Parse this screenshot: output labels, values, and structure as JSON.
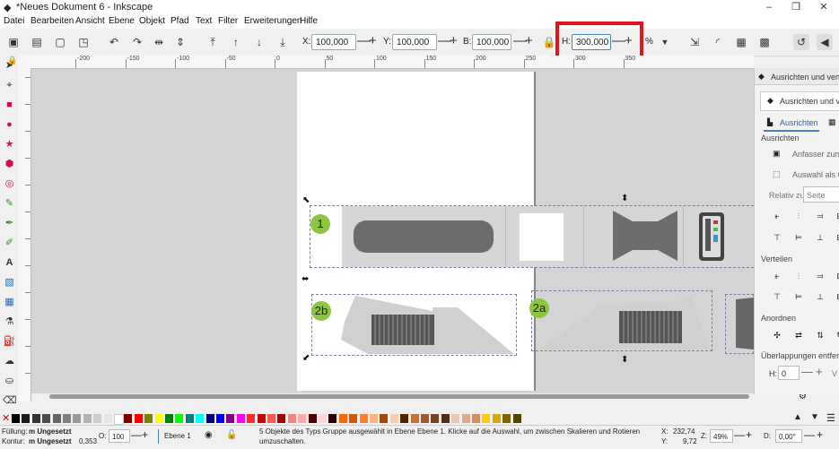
{
  "window": {
    "title": "*Neues Dokument 6 - Inkscape",
    "controls": [
      "–",
      "❐",
      "✕"
    ]
  },
  "menu": [
    "Datei",
    "Bearbeiten",
    "Ansicht",
    "Ebene",
    "Objekt",
    "Pfad",
    "Text",
    "Filter",
    "Erweiterungen",
    "Hilfe"
  ],
  "toolbar": {
    "x_label": "X:",
    "x_value": "100,000",
    "y_label": "Y:",
    "y_value": "100,000",
    "w_label": "B:",
    "w_value": "100,000",
    "h_label": "H:",
    "h_value": "300,000",
    "unit": "%",
    "minus": "—",
    "plus": "+"
  },
  "ruler": {
    "labels": [
      "-200",
      "-150",
      "-100",
      "-50",
      "0",
      "50",
      "100",
      "150",
      "200",
      "250",
      "300",
      "350"
    ]
  },
  "canvas": {
    "badges": [
      "1",
      "2b",
      "2a"
    ]
  },
  "dock": {
    "panel_title": "Ausrichten und verte",
    "tab_title": "Ausrichten und ve",
    "subtab": "Ausrichten",
    "section_align": "Ausrichten",
    "anchor_label": "Anfasser zum A",
    "selection_label": "Auswahl als Ga",
    "relative_label": "Relativ zu:",
    "relative_value": "Seite",
    "section_distribute": "Verteilen",
    "section_arrange": "Anordnen",
    "section_overlap": "Überlappungen entfern",
    "h_label": "H:",
    "h_value": "0",
    "v_label": "V"
  },
  "palette": {
    "colors": [
      "#000000",
      "#1a1a1a",
      "#333333",
      "#4d4d4d",
      "#666666",
      "#808080",
      "#999999",
      "#b3b3b3",
      "#cccccc",
      "#e6e6e6",
      "#ffffff",
      "#800000",
      "#ff0000",
      "#808000",
      "#ffff00",
      "#008000",
      "#00ff00",
      "#008080",
      "#00ffff",
      "#000080",
      "#0000ff",
      "#800080",
      "#ff00ff",
      "#ff2a2a",
      "#d40000",
      "#ff5555",
      "#aa0000",
      "#ff8080",
      "#ffaaaa",
      "#550000",
      "#ffd5d5",
      "#2b0000",
      "#ff6600",
      "#d45500",
      "#ff7f2a",
      "#ffb380",
      "#aa4400",
      "#ffccaa",
      "#552200",
      "#c87137",
      "#a05a2c",
      "#784421",
      "#502d16",
      "#e9c6af",
      "#deaa87",
      "#d38d5f",
      "#ffcc00",
      "#d4aa00",
      "#806600",
      "#554400"
    ]
  },
  "status": {
    "fill_label": "Füllung:",
    "fill_value": "m Ungesetzt",
    "stroke_label": "Kontur:",
    "stroke_value": "m Ungesetzt",
    "stroke_width": "0,353",
    "opacity_label": "O:",
    "opacity_value": "100",
    "layer": "Ebene 1",
    "message_line1": "5 Objekte des Typs Gruppe ausgewählt in Ebene Ebene 1. Klicke auf die Auswahl, um zwischen Skalieren und Rotieren",
    "message_line2": "umzuschalten.",
    "x_label": "X:",
    "x_value": "232,74",
    "y_label": "Y:",
    "y_value": "9,72",
    "zoom_label": "Z:",
    "zoom_value": "49%",
    "rot_label": "D:",
    "rot_value": "0,00°"
  }
}
